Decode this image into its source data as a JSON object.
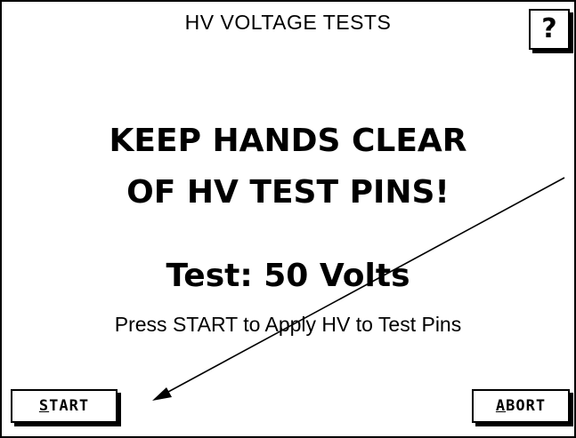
{
  "header": {
    "title": "HV VOLTAGE TESTS",
    "help_label": "?"
  },
  "warning": {
    "line1": "KEEP HANDS CLEAR",
    "line2": "OF HV TEST PINS!"
  },
  "test": {
    "value": "Test: 50 Volts",
    "instruction": "Press START to Apply HV to Test Pins"
  },
  "buttons": {
    "start": {
      "accel": "S",
      "rest": "TART"
    },
    "abort": {
      "accel": "A",
      "rest": "BORT"
    }
  },
  "colors": {
    "foreground": "#000000",
    "background": "#ffffff"
  },
  "icons": {
    "help": "question-mark-icon",
    "callout": "arrow-icon"
  }
}
